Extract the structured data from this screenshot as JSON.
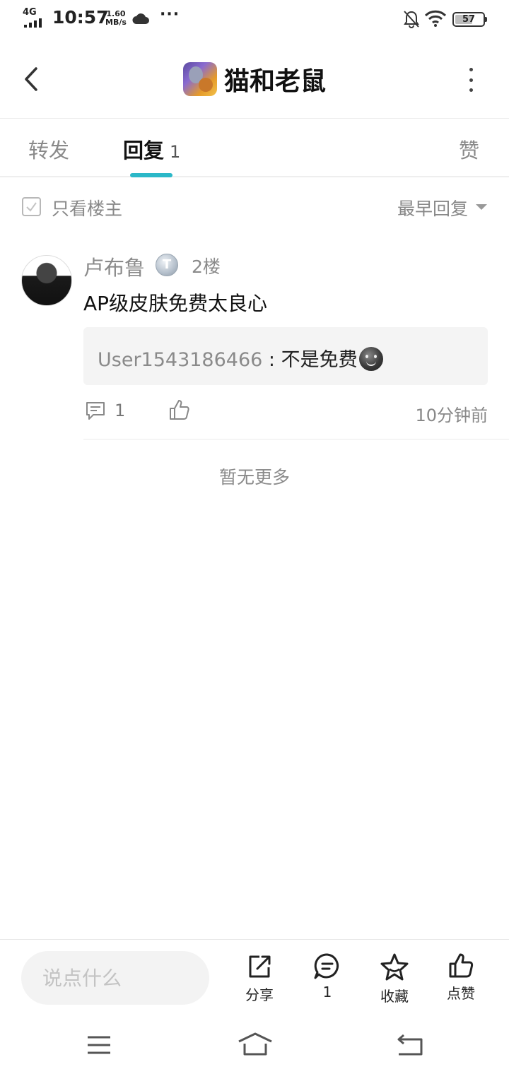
{
  "status_bar": {
    "network": "4G",
    "time": "10:57",
    "speed_value": "1.60",
    "speed_unit": "MB/s",
    "more": "···",
    "battery": "57"
  },
  "header": {
    "title": "猫和老鼠",
    "icons": {
      "back": "chevron-left-icon",
      "more": "more-vertical-icon"
    }
  },
  "tabs": {
    "forward": "转发",
    "reply": "回复",
    "reply_count": "1",
    "like": "赞",
    "active": "reply",
    "accent_color": "#2bb8c8"
  },
  "filter": {
    "only_op": "只看楼主",
    "sort": "最早回复"
  },
  "post": {
    "username": "卢布鲁",
    "level": "T",
    "floor": "2楼",
    "content": "AP级皮肤免费太良心",
    "quote": {
      "user": "User1543186466",
      "separator": " : ",
      "text": "不是免费"
    },
    "comment_count": "1",
    "time": "10分钟前"
  },
  "list_end": "暂无更多",
  "bottom_bar": {
    "input_placeholder": "说点什么",
    "share": "分享",
    "comment_count": "1",
    "favorite": "收藏",
    "like": "点赞"
  }
}
